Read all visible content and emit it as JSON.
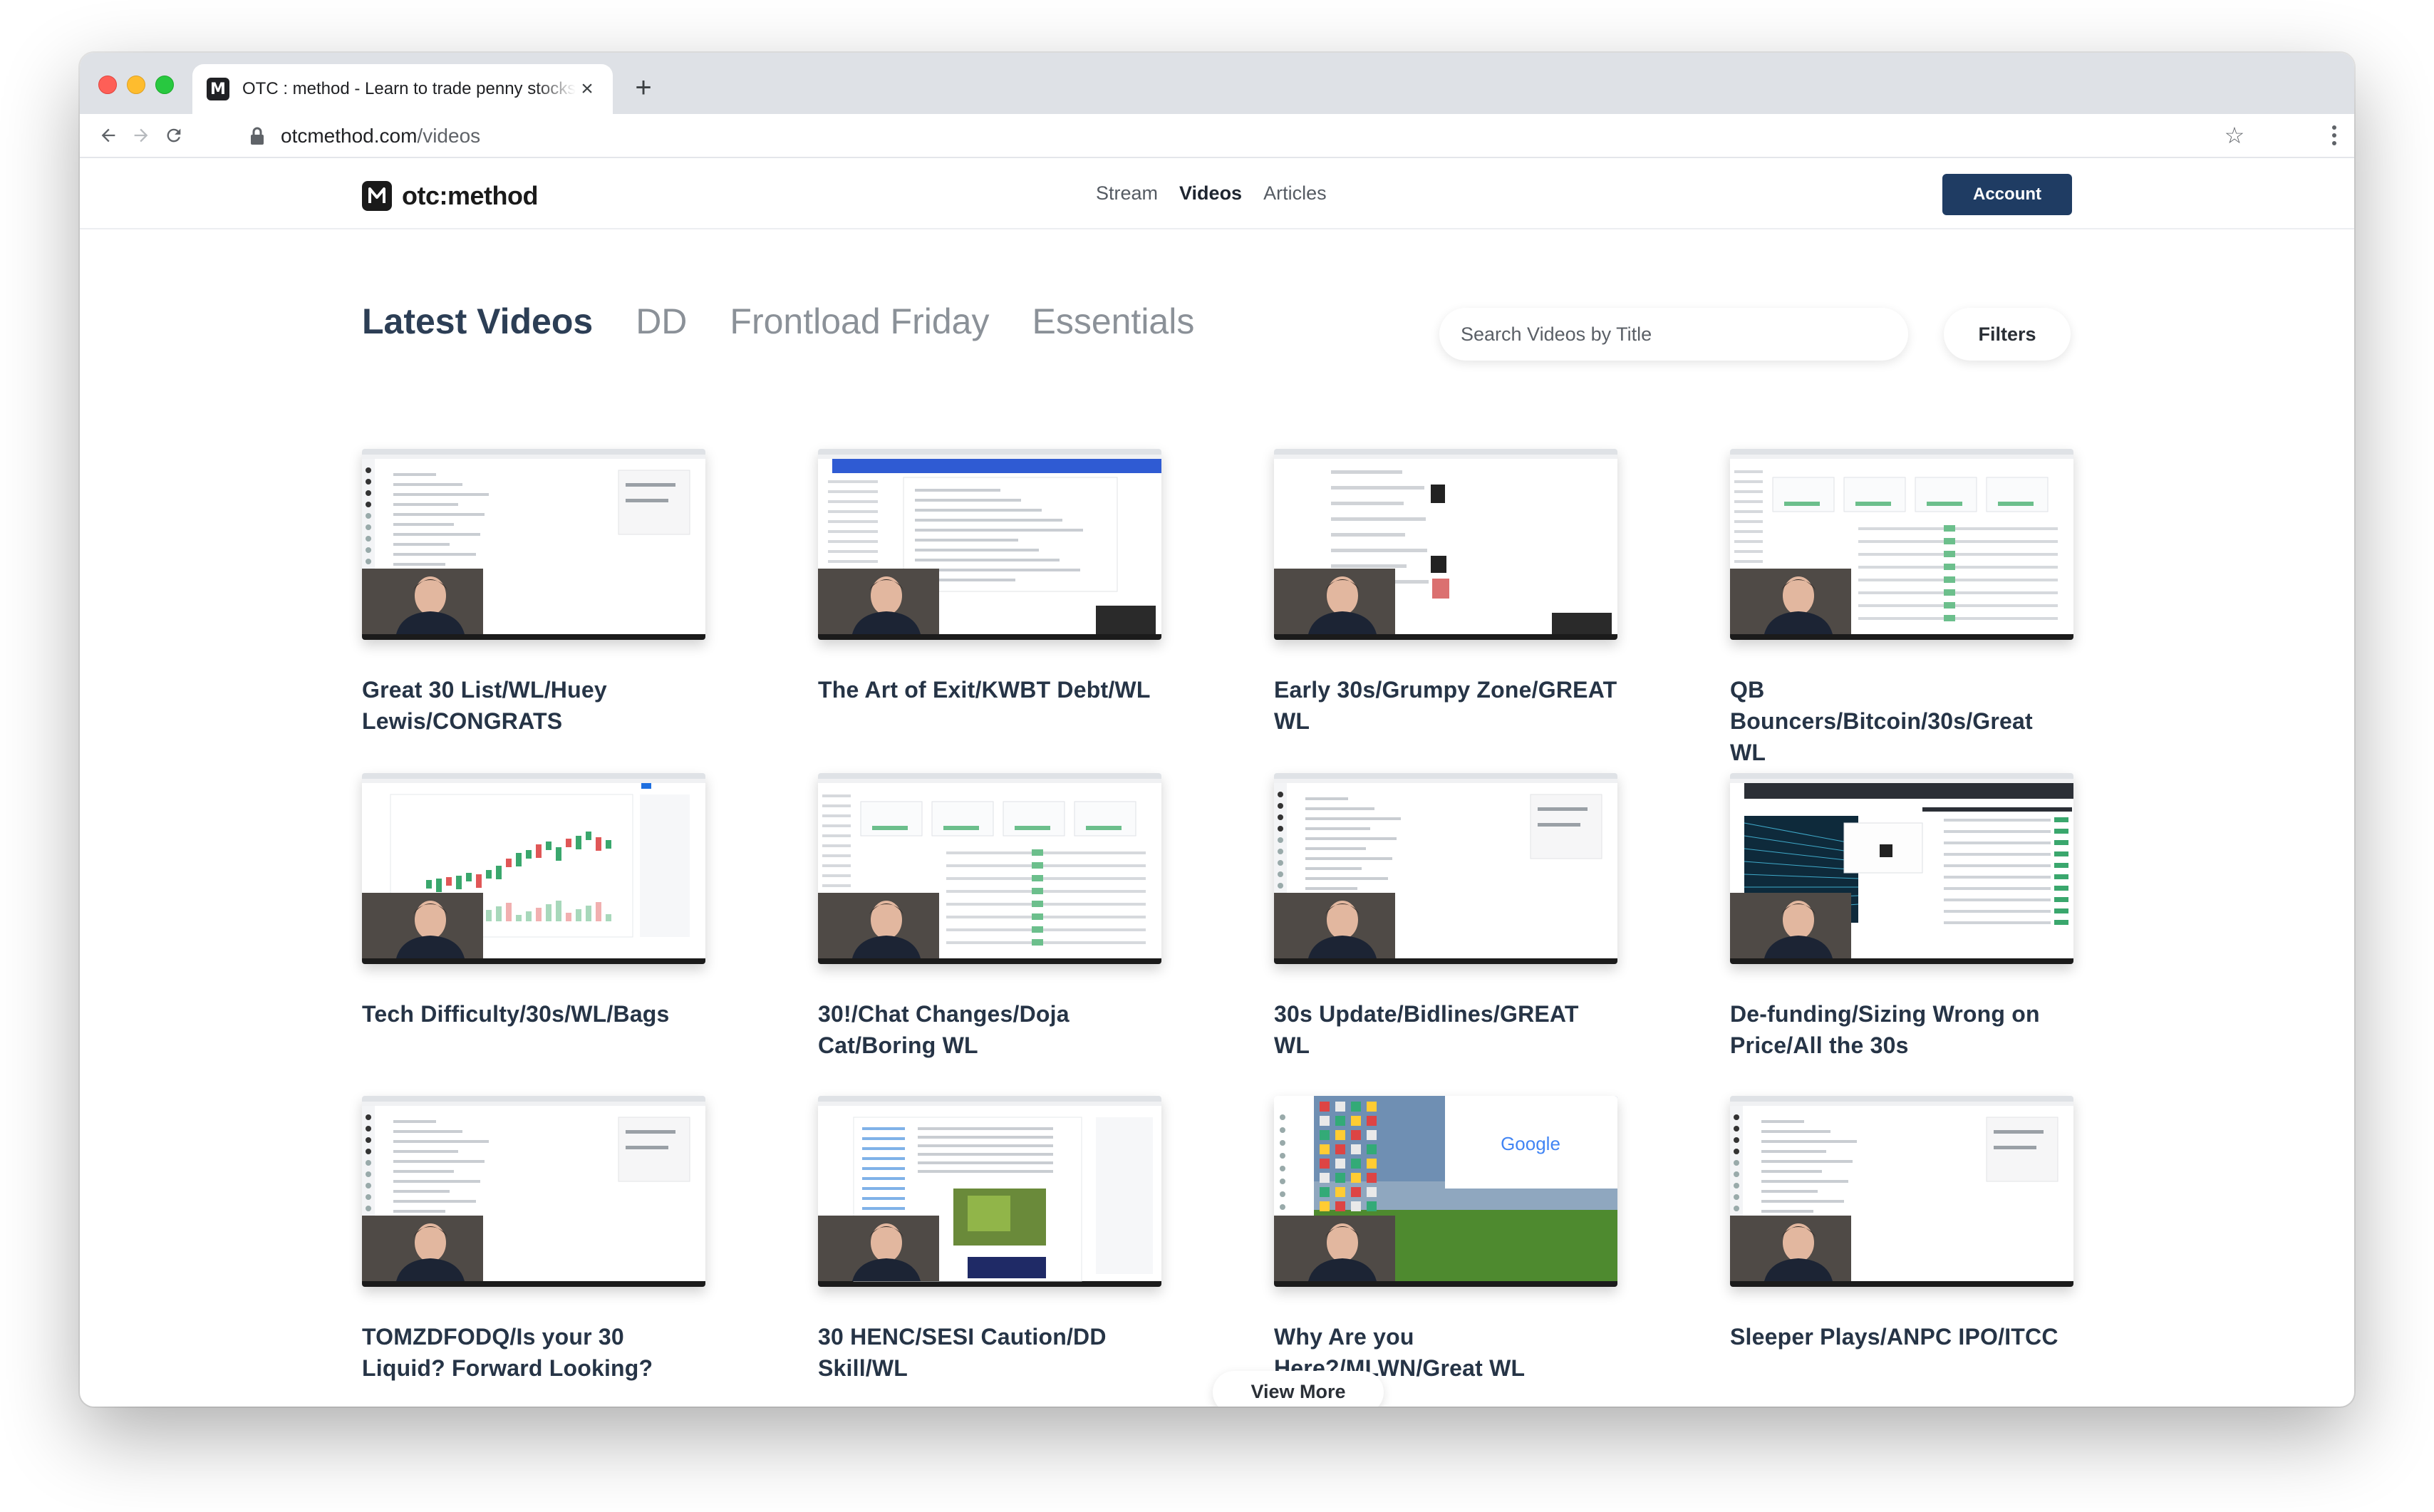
{
  "browser": {
    "tab_title": "OTC : method - Learn to trade penny stocks",
    "tab_favicon": "M",
    "new_tab_label": "+",
    "close_tab_label": "×",
    "url_host": "otcmethod.com",
    "url_path": "/videos",
    "icons": {
      "back": "arrow-left",
      "forward": "arrow-right",
      "reload": "reload",
      "lock": "lock",
      "bookmark": "star",
      "menu": "more-vertical"
    }
  },
  "site": {
    "logo_text": "otc:method",
    "nav": [
      {
        "label": "Stream",
        "active": false
      },
      {
        "label": "Videos",
        "active": true
      },
      {
        "label": "Articles",
        "active": false
      }
    ],
    "account_label": "Account",
    "accent_color": "#1f3c63"
  },
  "videos_page": {
    "tabs": [
      {
        "label": "Latest Videos",
        "active": true
      },
      {
        "label": "DD",
        "active": false
      },
      {
        "label": "Frontload Friday",
        "active": false
      },
      {
        "label": "Essentials",
        "active": false
      }
    ],
    "search_placeholder": "Search Videos by Title",
    "filters_label": "Filters",
    "view_more_label": "View More",
    "videos": [
      {
        "title": "Great 30 List/WL/Huey Lewis/CONGRATS",
        "thumb": "chat"
      },
      {
        "title": "The Art of Exit/KWBT Debt/WL",
        "thumb": "bluebar"
      },
      {
        "title": "Early 30s/Grumpy Zone/GREAT WL",
        "thumb": "page"
      },
      {
        "title": "QB Bouncers/Bitcoin/30s/Great WL",
        "thumb": "dashboard"
      },
      {
        "title": "Tech Difficulty/30s/WL/Bags",
        "thumb": "chart"
      },
      {
        "title": "30!/Chat Changes/Doja Cat/Boring WL",
        "thumb": "dashboard"
      },
      {
        "title": "30s Update/Bidlines/GREAT WL",
        "thumb": "chat"
      },
      {
        "title": "De-funding/Sizing Wrong on Price/All the 30s",
        "thumb": "darkheader"
      },
      {
        "title": "TOMZDFODQ/Is your 30 Liquid? Forward Looking?",
        "thumb": "chat"
      },
      {
        "title": "30 HENC/SESI Caution/DD Skill/WL",
        "thumb": "twitter"
      },
      {
        "title": "Why Are you Here?/MLWN/Great WL",
        "thumb": "desktop"
      },
      {
        "title": "Sleeper Plays/ANPC IPO/ITCC",
        "thumb": "chat"
      }
    ]
  },
  "thumbnail_text": {
    "google_logo": "Google"
  }
}
